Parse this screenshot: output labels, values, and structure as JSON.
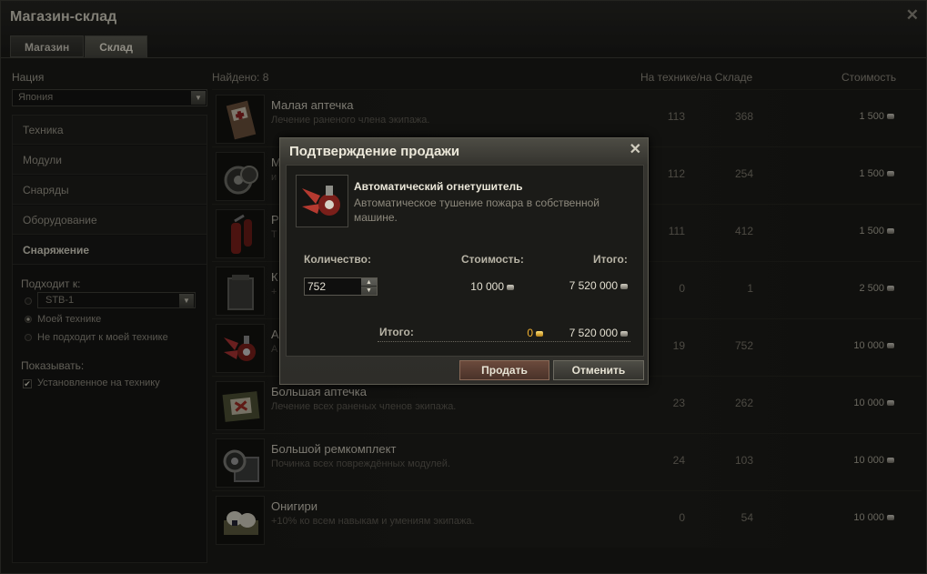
{
  "window": {
    "title": "Магазин-склад",
    "close_icon": "close-icon"
  },
  "tabs": [
    {
      "label": "Магазин",
      "active": false
    },
    {
      "label": "Склад",
      "active": true
    }
  ],
  "sidebar": {
    "nation_label": "Нация",
    "nation_value": "Япония",
    "nav_items": [
      {
        "label": "Техника",
        "selected": false
      },
      {
        "label": "Модули",
        "selected": false
      },
      {
        "label": "Снаряды",
        "selected": false
      },
      {
        "label": "Оборудование",
        "selected": false
      },
      {
        "label": "Снаряжение",
        "selected": true
      }
    ],
    "fits_label": "Подходит к:",
    "fits_vehicle": "STB-1",
    "fits_options": [
      {
        "label": "Моей технике",
        "checked": true
      },
      {
        "label": "Не подходит к моей технике",
        "checked": false
      }
    ],
    "show_label": "Показывать:",
    "show_installed": "Установленное на технику",
    "show_installed_checked": true
  },
  "list": {
    "found_label": "Найдено: 8",
    "col_qty": "На технике/на Складе",
    "col_price": "Стоимость",
    "items": [
      {
        "name": "Малая аптечка",
        "desc": "Лечение раненого члена экипажа.",
        "on_vehicle": "113",
        "in_store": "368",
        "price": "1 500",
        "icon": "small-medkit-icon"
      },
      {
        "name": "М",
        "desc": "и",
        "on_vehicle": "112",
        "in_store": "254",
        "price": "1 500",
        "icon": "small-repair-kit-icon"
      },
      {
        "name": "Р",
        "desc": "Т",
        "on_vehicle": "111",
        "in_store": "412",
        "price": "1 500",
        "icon": "manual-extinguisher-icon"
      },
      {
        "name": "К",
        "desc": "+",
        "on_vehicle": "0",
        "in_store": "1",
        "price": "2 500",
        "icon": "crate-icon"
      },
      {
        "name": "А",
        "desc": "А",
        "on_vehicle": "19",
        "in_store": "752",
        "price": "10 000",
        "icon": "auto-extinguisher-icon"
      },
      {
        "name": "Большая аптечка",
        "desc": "Лечение всех раненых членов экипажа.",
        "on_vehicle": "23",
        "in_store": "262",
        "price": "10 000",
        "icon": "large-medkit-icon"
      },
      {
        "name": "Большой ремкомплект",
        "desc": "Починка всех повреждённых модулей.",
        "on_vehicle": "24",
        "in_store": "103",
        "price": "10 000",
        "icon": "large-repair-kit-icon"
      },
      {
        "name": "Онигири",
        "desc": "+10% ко всем навыкам и умениям экипажа.",
        "on_vehicle": "0",
        "in_store": "54",
        "price": "10 000",
        "icon": "onigiri-icon"
      }
    ]
  },
  "dialog": {
    "title": "Подтверждение продажи",
    "item_name": "Автоматический огнетушитель",
    "item_desc": "Автоматическое тушение пожара в собственной машине.",
    "qty_label": "Количество:",
    "price_label": "Стоимость:",
    "total_label": "Итого:",
    "quantity": "752",
    "unit_price": "10 000",
    "subtotal": "7 520 000",
    "grand_total_label": "Итого:",
    "gold_total": "0",
    "credits_total": "7 520 000",
    "sell_button": "Продать",
    "cancel_button": "Отменить"
  },
  "colors": {
    "gold": "#f0b030",
    "accent_button": "#6b4a3c"
  }
}
